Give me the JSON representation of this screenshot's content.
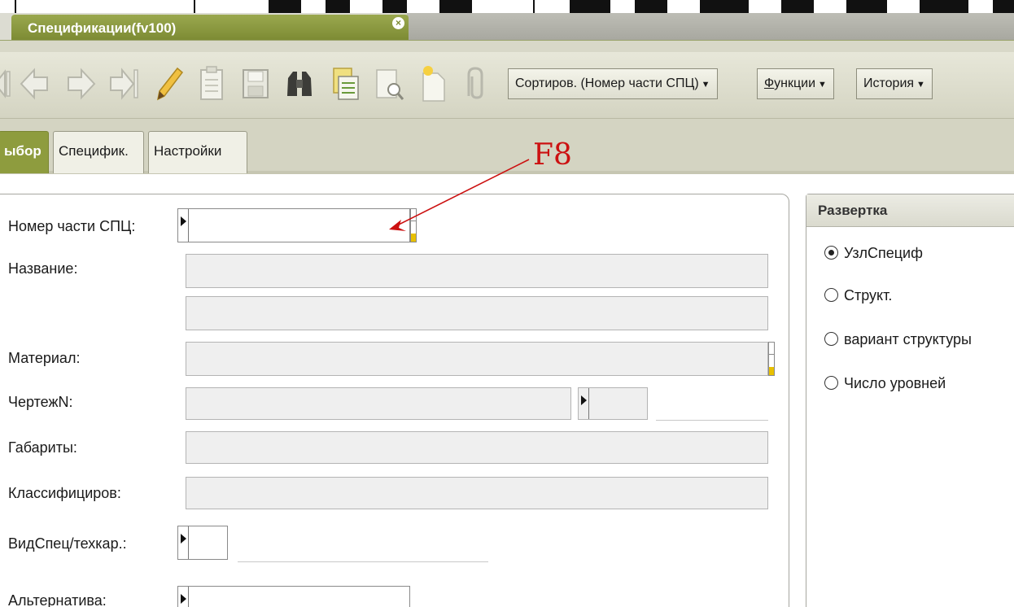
{
  "window": {
    "tab_title": "Спецификации(fv100)",
    "close_glyph": "×"
  },
  "toolbar": {
    "icons": [
      "first-record-icon",
      "previous-icon",
      "next-icon",
      "last-record-icon",
      "edit-pencil-icon",
      "clipboard-icon",
      "save-disk-icon",
      "binoculars-search-icon",
      "report-icon",
      "preview-icon",
      "new-document-icon",
      "attachment-icon"
    ],
    "sort_button": "Сортиров. (Номер части СПЦ)",
    "functions_button_first": "Ф",
    "functions_button_rest": "ункции",
    "history_button": "История",
    "dropdown_arrow": "▼"
  },
  "tabs": [
    {
      "label": "ыбор",
      "active": true
    },
    {
      "label": "Специфик.",
      "active": false
    },
    {
      "label": "Настройки",
      "active": false
    }
  ],
  "annotation": {
    "text": "F8",
    "color": "#cc1111"
  },
  "form": {
    "part_number_label": "Номер части СПЦ:",
    "part_number_value": "",
    "name_label": "Название:",
    "name_value": "",
    "name2_value": "",
    "material_label": "Материал:",
    "material_value": "",
    "drawing_label": "ЧертежN:",
    "drawing_value": "",
    "dimensions_label": "Габариты:",
    "dimensions_value": "",
    "classifier_label": "Классифициров:",
    "classifier_value": "",
    "spec_type_label": "ВидСпец/техкар.:",
    "spec_type_value": "",
    "alternative_label": "Альтернатива:",
    "alternative_value": ""
  },
  "expand_panel": {
    "title": "Развертка",
    "options": [
      {
        "label": "УзлСпециф",
        "selected": true
      },
      {
        "label": "Структ.",
        "selected": false
      },
      {
        "label": "вариант структуры",
        "selected": false
      },
      {
        "label": "Число уровней",
        "selected": false
      }
    ]
  },
  "colors": {
    "accent_olive": "#8e9c3e",
    "toolbar_bg": "#dcdcc8",
    "field_yellow": "#e8c000"
  }
}
